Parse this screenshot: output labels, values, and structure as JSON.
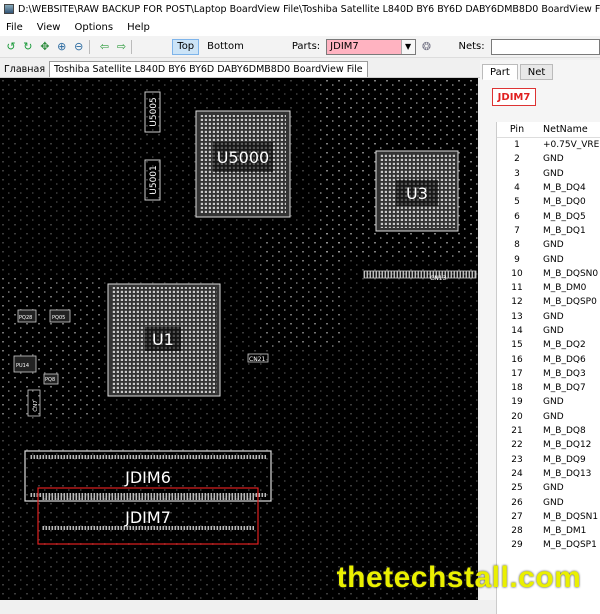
{
  "window": {
    "title": "D:\\WEBSITE\\RAW BACKUP FOR POST\\Laptop BoardView File\\Toshiba Satellite L840D BY6 BY6D DABY6DMB8D0 BoardView File\\Toshiba Satellite"
  },
  "menu": [
    "File",
    "View",
    "Options",
    "Help"
  ],
  "toolbar": {
    "top_label": "Top",
    "bottom_label": "Bottom",
    "parts_label": "Parts:",
    "parts_value": "JDIM7",
    "nets_label": "Nets:",
    "nets_value": ""
  },
  "doc_tabs": [
    "Главная",
    "Toshiba Satellite L840D BY6 BY6D DABY6DMB8D0 BoardView File"
  ],
  "board": {
    "components": [
      {
        "ref": "U5000"
      },
      {
        "ref": "U3"
      },
      {
        "ref": "U1"
      },
      {
        "ref": "JDIM6"
      },
      {
        "ref": "JDIM7"
      },
      {
        "ref": "U5005"
      },
      {
        "ref": "U5001"
      },
      {
        "ref": "CN13"
      },
      {
        "ref": "CN21"
      },
      {
        "ref": "CN7"
      },
      {
        "ref": "PQ28"
      },
      {
        "ref": "PQ05"
      },
      {
        "ref": "PU14"
      },
      {
        "ref": "PQ8"
      }
    ],
    "selected_color": "#e02020"
  },
  "panel": {
    "tabs": [
      "Part",
      "Net"
    ],
    "selected_part": "JDIM7",
    "columns": [
      "Pin",
      "NetName"
    ],
    "rows": [
      [
        "1",
        "+0.75V_VREF"
      ],
      [
        "2",
        "GND"
      ],
      [
        "3",
        "GND"
      ],
      [
        "4",
        "M_B_DQ4"
      ],
      [
        "5",
        "M_B_DQ0"
      ],
      [
        "6",
        "M_B_DQ5"
      ],
      [
        "7",
        "M_B_DQ1"
      ],
      [
        "8",
        "GND"
      ],
      [
        "9",
        "GND"
      ],
      [
        "10",
        "M_B_DQSN0"
      ],
      [
        "11",
        "M_B_DM0"
      ],
      [
        "12",
        "M_B_DQSP0"
      ],
      [
        "13",
        "GND"
      ],
      [
        "14",
        "GND"
      ],
      [
        "15",
        "M_B_DQ2"
      ],
      [
        "16",
        "M_B_DQ6"
      ],
      [
        "17",
        "M_B_DQ3"
      ],
      [
        "18",
        "M_B_DQ7"
      ],
      [
        "19",
        "GND"
      ],
      [
        "20",
        "GND"
      ],
      [
        "21",
        "M_B_DQ8"
      ],
      [
        "22",
        "M_B_DQ12"
      ],
      [
        "23",
        "M_B_DQ9"
      ],
      [
        "24",
        "M_B_DQ13"
      ],
      [
        "25",
        "GND"
      ],
      [
        "26",
        "GND"
      ],
      [
        "27",
        "M_B_DQSN1"
      ],
      [
        "28",
        "M_B_DM1"
      ],
      [
        "29",
        "M_B_DQSP1"
      ]
    ]
  },
  "watermark": "thetechstall.com"
}
